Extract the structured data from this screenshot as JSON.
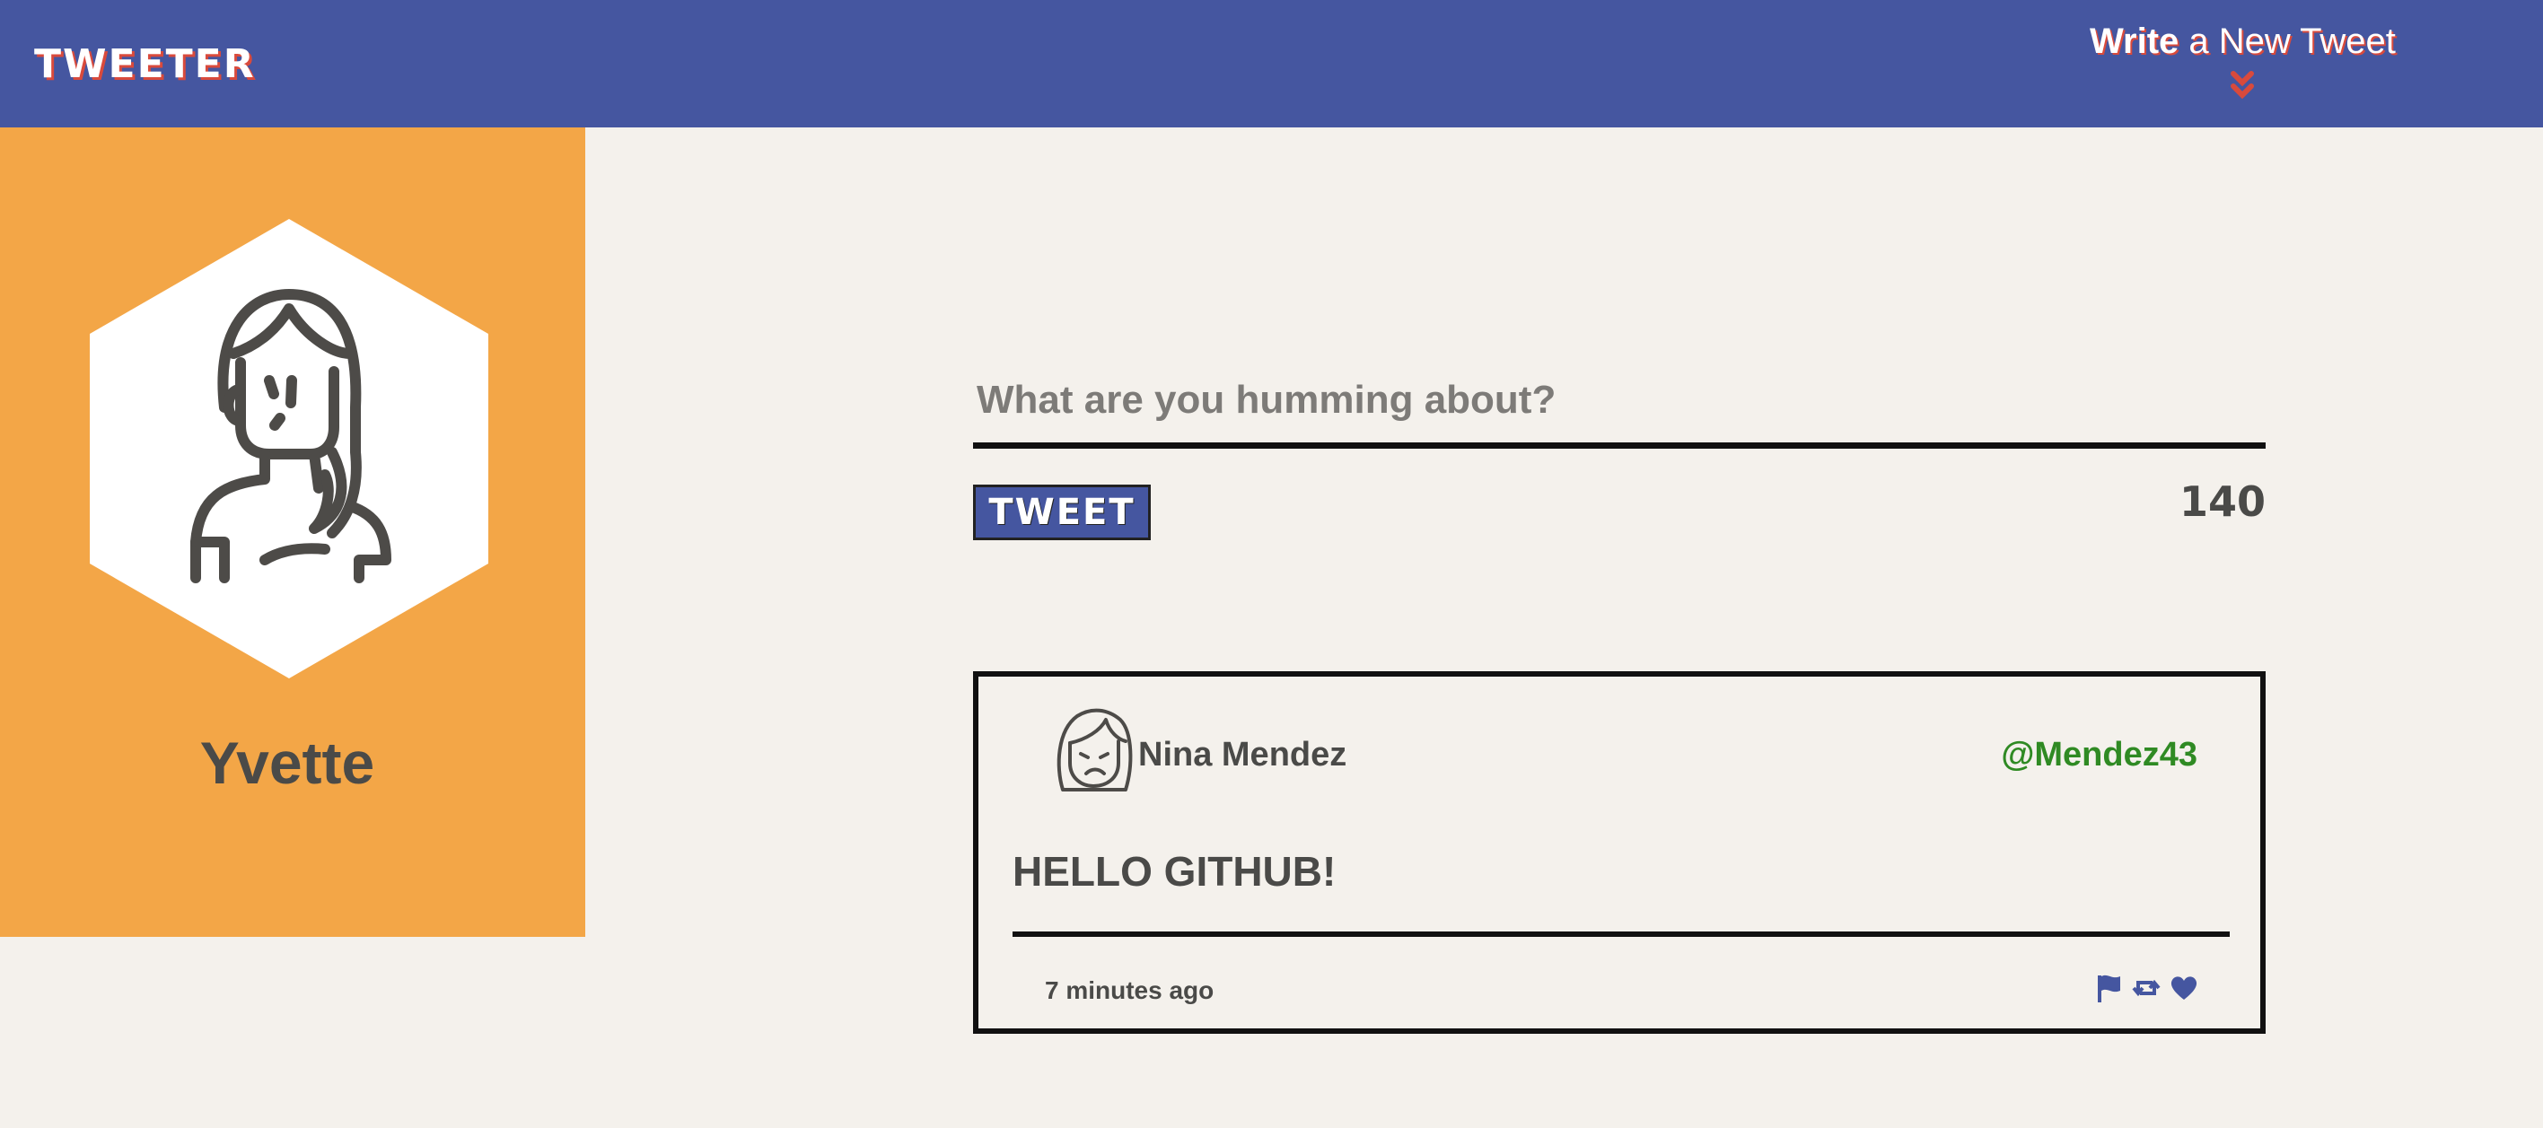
{
  "header": {
    "brand": "TWEETER",
    "compose_link_bold": "Write",
    "compose_link_rest": " a New Tweet"
  },
  "profile": {
    "name": "Yvette"
  },
  "compose": {
    "placeholder": "What are you humming about?",
    "button_label": "TWEET",
    "counter": "140"
  },
  "tweet": {
    "author_name": "Nina Mendez",
    "handle": "@Mendez43",
    "text": "HELLO GITHUB!",
    "timestamp": "7 minutes ago",
    "actions": [
      "flag-icon",
      "retweet-icon",
      "heart-icon"
    ]
  },
  "colors": {
    "header": "#4556a0",
    "sidebar": "#f3a647",
    "background": "#f4f1ec",
    "handle": "#2f8a23",
    "accent_red": "#d94a3c"
  }
}
